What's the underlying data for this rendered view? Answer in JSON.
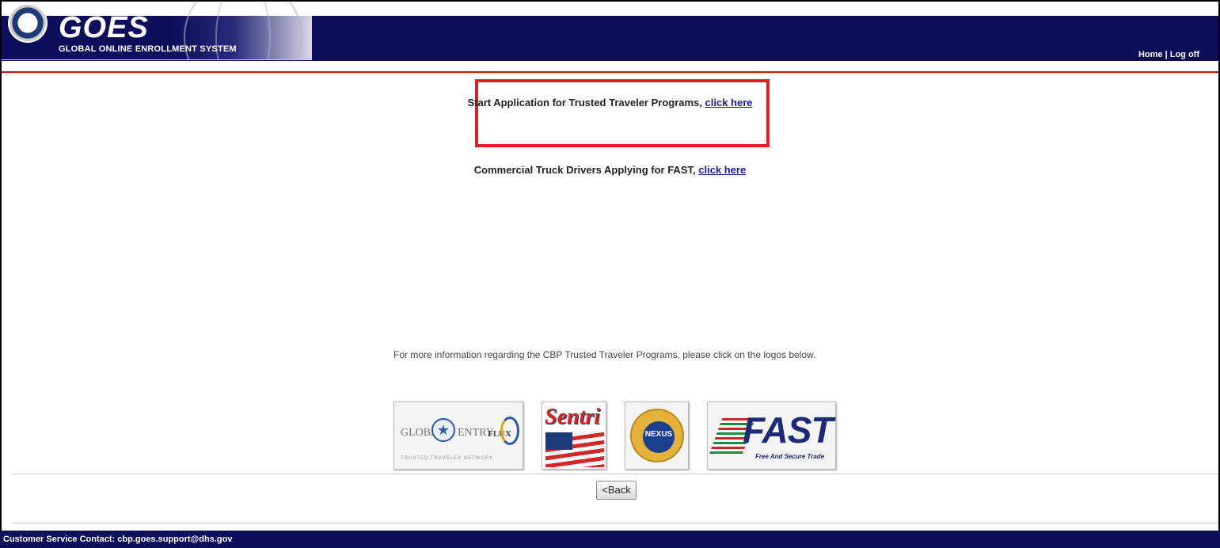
{
  "header": {
    "brand": "GOES",
    "brand_subtitle": "GLOBAL ONLINE ENROLLMENT SYSTEM",
    "home_label": "Home",
    "separator": "|",
    "logoff_label": "Log off"
  },
  "content": {
    "trusted_traveler_text": "Start Application for Trusted Traveler Programs, ",
    "trusted_traveler_link": "click here",
    "fast_text": "Commercial Truck Drivers Applying for FAST, ",
    "fast_link": "click here",
    "info_text": "For more information regarding the CBP Trusted Traveler Programs, please click on the logos below."
  },
  "logos": {
    "global_entry": {
      "left_text": "GLOBAL",
      "right_text": "ENTRY",
      "flux_text": "FLUX",
      "sub_text": "TRUSTED TRAVELER NETWORK"
    },
    "sentri": {
      "text": "Sentri"
    },
    "nexus": {
      "text": "NEXUS"
    },
    "fast": {
      "text": "FAST",
      "sub_text": "Free And Secure Trade"
    }
  },
  "buttons": {
    "back_label": "<Back"
  },
  "footer": {
    "contact_text": "Customer Service Contact: cbp.goes.support@dhs.gov"
  },
  "colors": {
    "header_navy": "#0d0d5c",
    "highlight_red": "#e02020",
    "link_blue": "#1a1aa6"
  }
}
